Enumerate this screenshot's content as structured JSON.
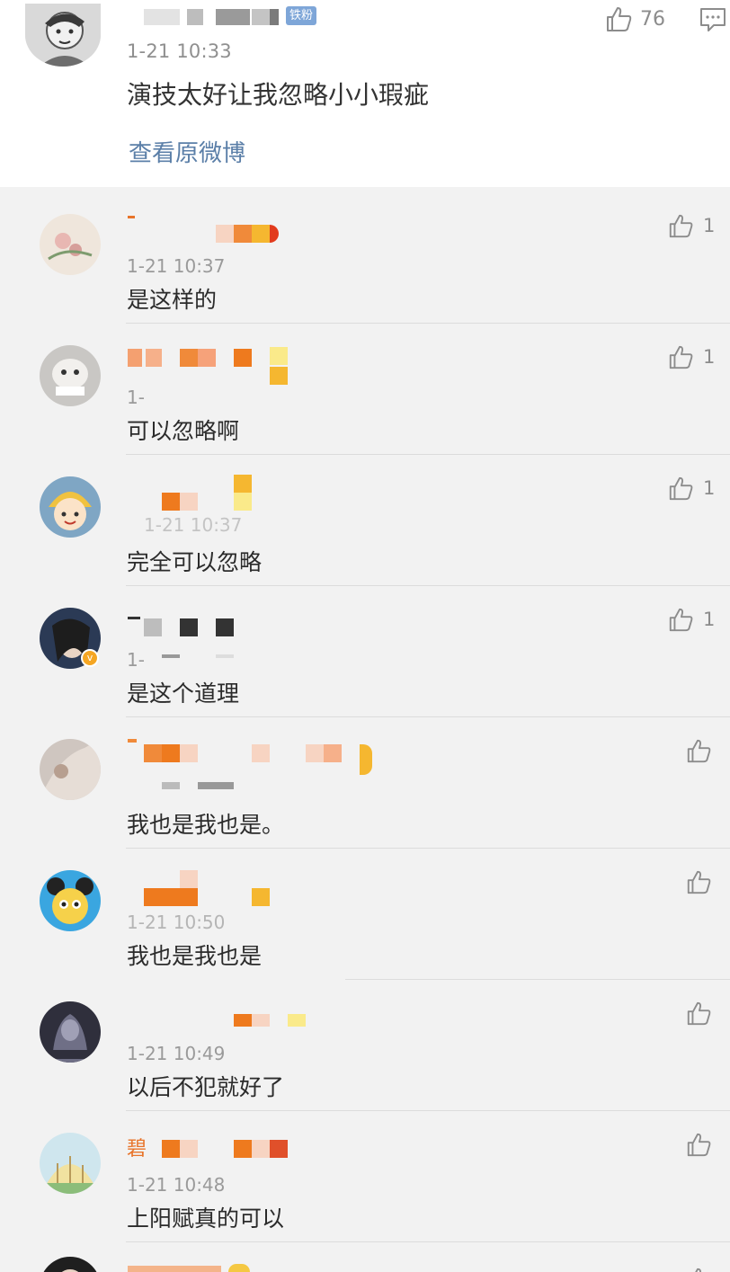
{
  "main_comment": {
    "badge": "铁粉",
    "time": "1-21 10:33",
    "text": "演技太好让我忽略小小瑕疵",
    "like_count": "76",
    "view_original": "查看原微博"
  },
  "replies": [
    {
      "name_prefix": "",
      "time": "1-21 10:37",
      "text": "是这样的",
      "like_count": "1"
    },
    {
      "name_prefix": "",
      "time": "1-",
      "text": "可以忽略啊",
      "like_count": "1"
    },
    {
      "name_prefix": "",
      "time": "1-21 10:37",
      "text": "完全可以忽略",
      "like_count": "1"
    },
    {
      "name_prefix": "",
      "time": "1-",
      "text": "是这个道理",
      "like_count": "1"
    },
    {
      "name_prefix": "",
      "time": "",
      "text": "我也是我也是。",
      "like_count": ""
    },
    {
      "name_prefix": "",
      "time": "1-21 10:50",
      "text": "我也是我也是",
      "like_count": ""
    },
    {
      "name_prefix": "",
      "time": "1-21 10:49",
      "text": "以后不犯就好了",
      "like_count": ""
    },
    {
      "name_prefix": "碧",
      "time": "1-21 10:48",
      "text": "上阳赋真的可以",
      "like_count": ""
    },
    {
      "name_prefix": "",
      "time": "",
      "text": "",
      "like_count": ""
    }
  ],
  "icons": {
    "like": "thumbs-up-icon",
    "comment": "comment-icon",
    "verified": "verified-badge-icon"
  },
  "colors": {
    "link": "#5b7fa8",
    "username": "#e8742a",
    "badge": "#7ea6d8",
    "verified": "#f5a623"
  }
}
